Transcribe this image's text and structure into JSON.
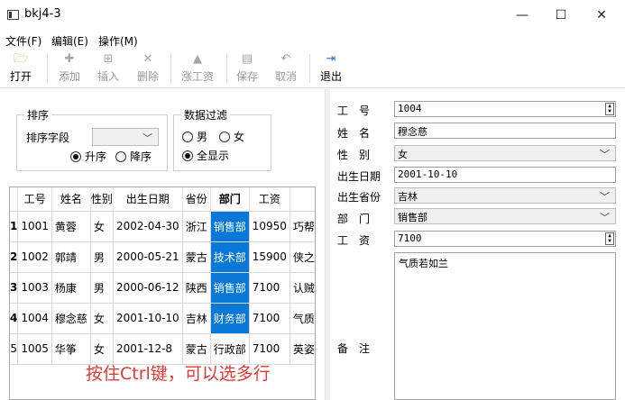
{
  "window": {
    "title": "bkj4-3",
    "minimize": "—",
    "maximize": "☐",
    "close": "✕"
  },
  "menu": [
    {
      "label": "文件(F)"
    },
    {
      "label": "编辑(E)"
    },
    {
      "label": "操作(M)"
    }
  ],
  "toolbar": {
    "open": {
      "label": "打开",
      "icon": "folder-icon",
      "glyph": "🗁"
    },
    "add": {
      "label": "添加",
      "icon": "plus-icon",
      "glyph": "✚"
    },
    "insert": {
      "label": "插入",
      "icon": "insert-icon",
      "glyph": "⊞"
    },
    "delete": {
      "label": "删除",
      "icon": "cross-icon",
      "glyph": "✕"
    },
    "raise": {
      "label": "涨工资",
      "icon": "up-arrow-icon",
      "glyph": "▲"
    },
    "save": {
      "label": "保存",
      "icon": "floppy-icon",
      "glyph": "▤"
    },
    "cancel": {
      "label": "取消",
      "icon": "undo-icon",
      "glyph": "↶"
    },
    "exit": {
      "label": "退出",
      "icon": "exit-icon",
      "glyph": "⇥"
    }
  },
  "sort": {
    "group_title": "排序",
    "field_label": "排序字段",
    "field_value": "",
    "asc": "升序",
    "desc": "降序",
    "selected": "asc"
  },
  "filter": {
    "group_title": "数据过滤",
    "male": "男",
    "female": "女",
    "all": "全显示",
    "selected": "all"
  },
  "table": {
    "headers": [
      "工号",
      "姓名",
      "性别",
      "出生日期",
      "省份",
      "部门",
      "工资",
      ""
    ],
    "rows": [
      {
        "num": "1",
        "cells": [
          "1001",
          "黄蓉",
          "女",
          "2002-04-30",
          "浙江",
          "销售部",
          "10950",
          "巧帮"
        ],
        "selected": true
      },
      {
        "num": "2",
        "cells": [
          "1002",
          "郭靖",
          "男",
          "2000-05-21",
          "蒙古",
          "技术部",
          "15900",
          "侠之"
        ],
        "selected": true
      },
      {
        "num": "3",
        "cells": [
          "1003",
          "杨康",
          "男",
          "2000-06-12",
          "陕西",
          "销售部",
          "7100",
          "认贼"
        ],
        "selected": true
      },
      {
        "num": "4",
        "cells": [
          "1004",
          "穆念慈",
          "女",
          "2001-10-10",
          "吉林",
          "财务部",
          "7100",
          "气质"
        ],
        "selected": true
      },
      {
        "num": "5",
        "cells": [
          "1005",
          "华筝",
          "女",
          "2001-12-8",
          "蒙古",
          "行政部",
          "7100",
          "英姿"
        ],
        "selected": false
      }
    ]
  },
  "hint": "按住Ctrl键，可以选多行",
  "form": {
    "id_label": "工　号",
    "id_value": "1004",
    "name_label": "姓　名",
    "name_value": "穆念慈",
    "gender_label": "性　别",
    "gender_value": "女",
    "birth_label": "出生日期",
    "birth_value": "2001-10-10",
    "province_label": "出生省份",
    "province_value": "吉林",
    "dept_label": "部　门",
    "dept_value": "销售部",
    "salary_label": "工　资",
    "salary_value": "7100",
    "memo_label": "备　注",
    "memo_value": "气质若如兰"
  },
  "colors": {
    "selection": "#0a78d7",
    "hint": "#e53935"
  }
}
